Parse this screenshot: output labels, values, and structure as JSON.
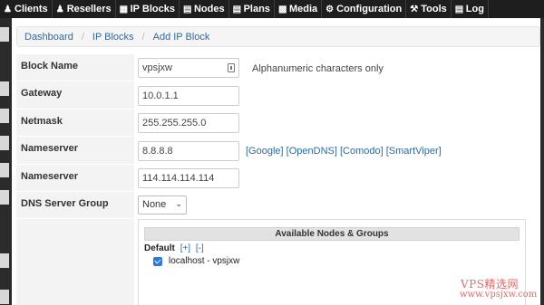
{
  "nav": {
    "items": [
      {
        "label": "Clients",
        "icon": "users-icon"
      },
      {
        "label": "Resellers",
        "icon": "user-icon"
      },
      {
        "label": "IP Blocks",
        "icon": "grid-icon"
      },
      {
        "label": "Nodes",
        "icon": "server-icon"
      },
      {
        "label": "Plans",
        "icon": "list-icon"
      },
      {
        "label": "Media",
        "icon": "media-icon"
      },
      {
        "label": "Configuration",
        "icon": "gear-icon"
      },
      {
        "label": "Tools",
        "icon": "wrench-icon"
      },
      {
        "label": "Log",
        "icon": "log-icon"
      }
    ]
  },
  "breadcrumb": {
    "items": [
      "Dashboard",
      "IP Blocks",
      "Add IP Block"
    ],
    "separator": "/"
  },
  "form": {
    "block_name": {
      "label": "Block Name",
      "value": "vpsjxw",
      "hint": "Alphanumeric characters only"
    },
    "gateway": {
      "label": "Gateway",
      "value": "10.0.1.1"
    },
    "netmask": {
      "label": "Netmask",
      "value": "255.255.255.0"
    },
    "nameserver1": {
      "label": "Nameserver",
      "value": "8.8.8.8"
    },
    "nameserver2": {
      "label": "Nameserver",
      "value": "114.114.114.114"
    },
    "dns_group": {
      "label": "DNS Server Group",
      "value": "None"
    },
    "ns_links": [
      "[Google]",
      "[OpenDNS]",
      "[Comodo]",
      "[SmartViper]"
    ]
  },
  "nodes": {
    "header": "Available Nodes & Groups",
    "group_name": "Default",
    "expand": "[+]",
    "collapse": "[-]",
    "items": [
      {
        "label": "localhost - vpsjxw",
        "checked": true
      }
    ]
  },
  "watermark": {
    "line1": "VPS精选网",
    "line2": "www.vpsjxw.com"
  },
  "colors": {
    "nav_bg": "#1e1e1e",
    "link": "#2a6aa8",
    "checkbox": "#2a7ae2",
    "watermark": "#e26a6a"
  }
}
